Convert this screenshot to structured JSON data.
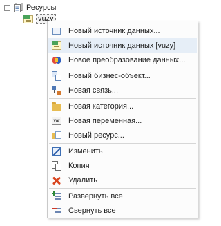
{
  "tree": {
    "root_label": "Ресурсы",
    "root_icon": "collection-icon",
    "child_label": "vuzy",
    "child_icon": "data-source-icon",
    "expander_icon": "collapse-minus-icon"
  },
  "menu": {
    "items": [
      {
        "label": "Новый источник данных...",
        "icon": "table-icon"
      },
      {
        "label": "Новый источник данных [vuzy]",
        "icon": "data-source-icon",
        "highlighted": true
      },
      {
        "label": "Новое преобразование данных...",
        "icon": "transform-icon"
      },
      {
        "label": "Новый бизнес-объект...",
        "icon": "business-object-icon"
      },
      {
        "label": "Новая связь...",
        "icon": "relation-icon"
      },
      {
        "label": "Новая категория...",
        "icon": "folder-icon"
      },
      {
        "label": "Новая переменная...",
        "icon": "variable-icon"
      },
      {
        "label": "Новый ресурс...",
        "icon": "resource-icon"
      },
      {
        "label": "Изменить",
        "icon": "edit-icon"
      },
      {
        "label": "Копия",
        "icon": "copy-icon"
      },
      {
        "label": "Удалить",
        "icon": "delete-icon"
      },
      {
        "label": "Развернуть все",
        "icon": "expand-all-icon"
      },
      {
        "label": "Свернуть все",
        "icon": "collapse-all-icon"
      }
    ]
  },
  "colors": {
    "highlight": "#e6eef7",
    "menu_border": "#c9c9c9",
    "separator": "#d6d6d6"
  }
}
